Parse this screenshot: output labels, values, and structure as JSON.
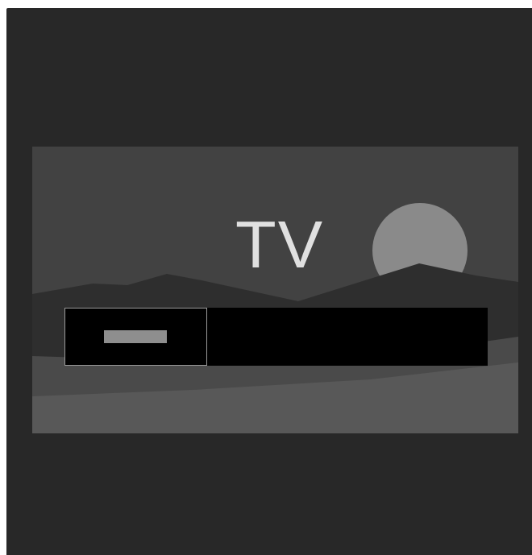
{
  "screen": {
    "label": "TV",
    "colors": {
      "frame_bg": "#282828",
      "sky": "#424242",
      "sun": "#8a8a8a",
      "hills": "#2e2e2e",
      "ground": "#585858",
      "bar": "#000000",
      "tile_border": "#9a9a9a",
      "indicator": "#8e8e8e",
      "text": "#e0e0e0"
    }
  },
  "launcher": {
    "tiles": [
      {
        "selected": true
      }
    ]
  }
}
